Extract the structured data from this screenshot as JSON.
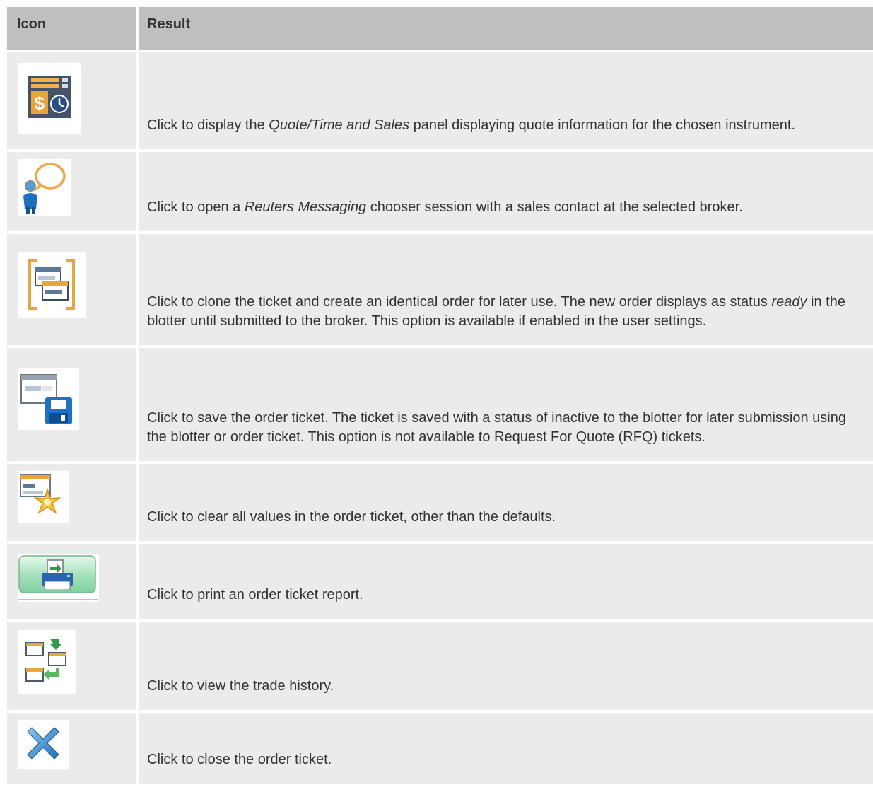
{
  "table": {
    "headers": {
      "icon": "Icon",
      "result": "Result"
    },
    "rows": [
      {
        "icon_name": "quote-time-sales-icon",
        "pre": "Click to display the ",
        "em": "Quote/Time and Sales",
        "post": " panel displaying quote information for the chosen instrument."
      },
      {
        "icon_name": "messaging-contact-icon",
        "pre": "Click to open a ",
        "em": "Reuters Messaging",
        "post": " chooser session with a sales contact at the selected broker."
      },
      {
        "icon_name": "clone-ticket-icon",
        "pre": "Click to clone the ticket and create an identical order for later use. The new order displays as status ",
        "em": "ready",
        "post": " in the blotter until submitted to the broker. This option is available if enabled in the user settings."
      },
      {
        "icon_name": "save-ticket-icon",
        "text": "Click to save the order ticket. The ticket is saved with a status of inactive to the blotter for later submission using the blotter or order ticket. This option is not available to Request For Quote (RFQ) tickets."
      },
      {
        "icon_name": "clear-values-icon",
        "text": "Click to clear all values in the order ticket, other than the defaults."
      },
      {
        "icon_name": "print-report-icon",
        "text": "Click to print an order ticket report."
      },
      {
        "icon_name": "trade-history-icon",
        "text": "Click to view the trade history."
      },
      {
        "icon_name": "close-ticket-icon",
        "text": "Click to close the order ticket."
      }
    ]
  },
  "colors": {
    "header_bg": "#bfbfbf",
    "row_bg": "#ebebeb",
    "text": "#333333"
  }
}
